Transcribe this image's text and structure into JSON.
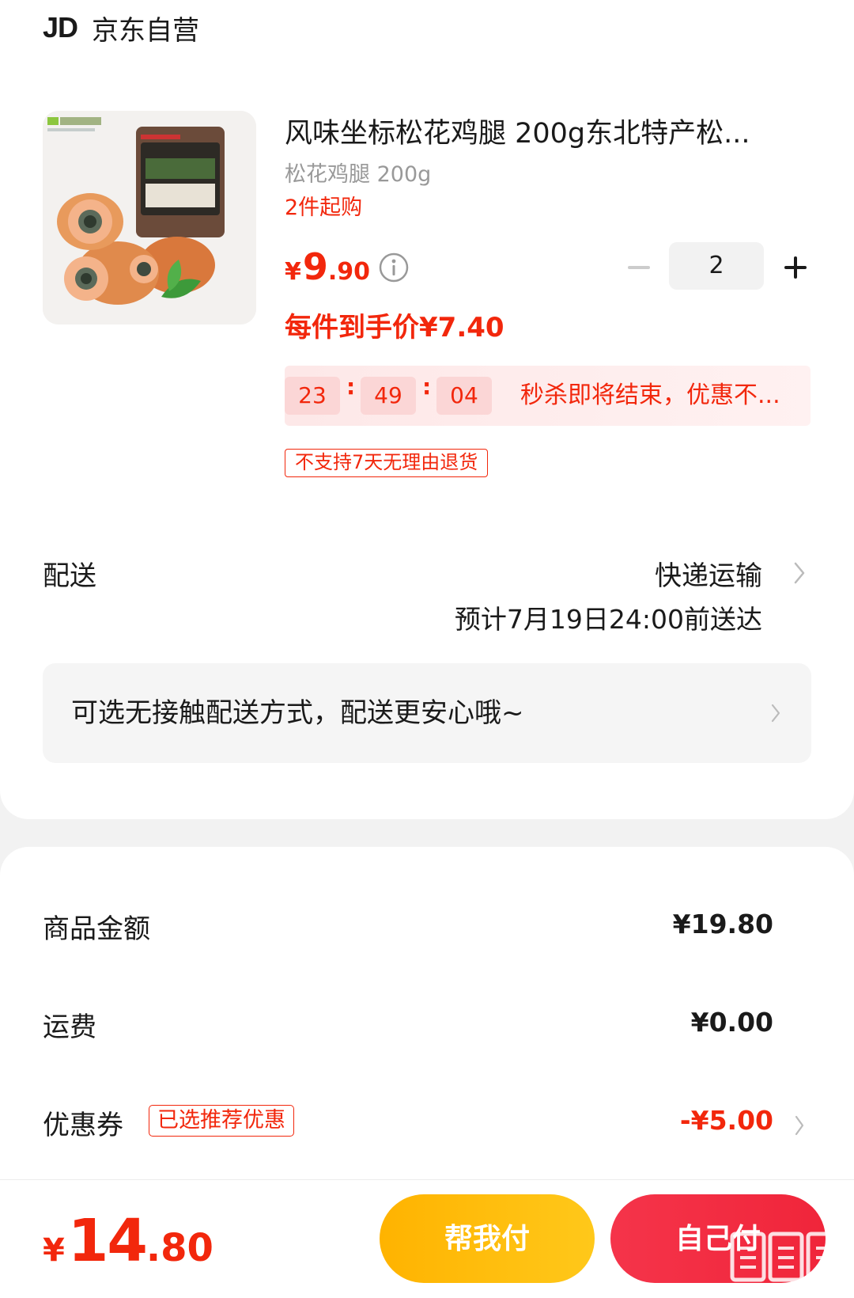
{
  "store": {
    "logo_text": "JD",
    "name": "京东自营"
  },
  "product": {
    "image_icon": "product-photo-songhua-chicken-leg",
    "title": "风味坐标松花鸡腿 200g东北特产松...",
    "spec": "松花鸡腿 200g",
    "min_purchase": "2件起购",
    "price": {
      "symbol": "¥",
      "integer": "9",
      "decimal": ".90"
    },
    "price_info_icon": "info-icon",
    "quantity": "2",
    "final_price": "每件到手价¥7.40",
    "countdown": {
      "hours": "23",
      "minutes": "49",
      "seconds": "04",
      "separator": ":"
    },
    "flash_sale_text": "秒杀即将结束，优惠不...",
    "return_policy": "不支持7天无理由退货"
  },
  "delivery": {
    "label": "配送",
    "method": "快递运输",
    "eta": "预计7月19日24:00前送达",
    "contactless_text": "可选无接触配送方式，配送更安心哦~"
  },
  "summary": {
    "goods_label": "商品金额",
    "goods_value": "¥19.80",
    "shipping_label": "运费",
    "shipping_value": "¥0.00",
    "coupon_label": "优惠券",
    "coupon_tag": "已选推荐优惠",
    "coupon_value": "-¥5.00"
  },
  "bottom": {
    "total": {
      "symbol": "¥",
      "integer": "14",
      "decimal": ".80"
    },
    "friend_pay_label": "帮我付",
    "self_pay_label": "自己付",
    "watermark": "zhizhizhi.com"
  },
  "colors": {
    "accent_red": "#f2270c",
    "friend_pay_yellow": "#ffb300",
    "self_pay_red": "#f0253a"
  }
}
